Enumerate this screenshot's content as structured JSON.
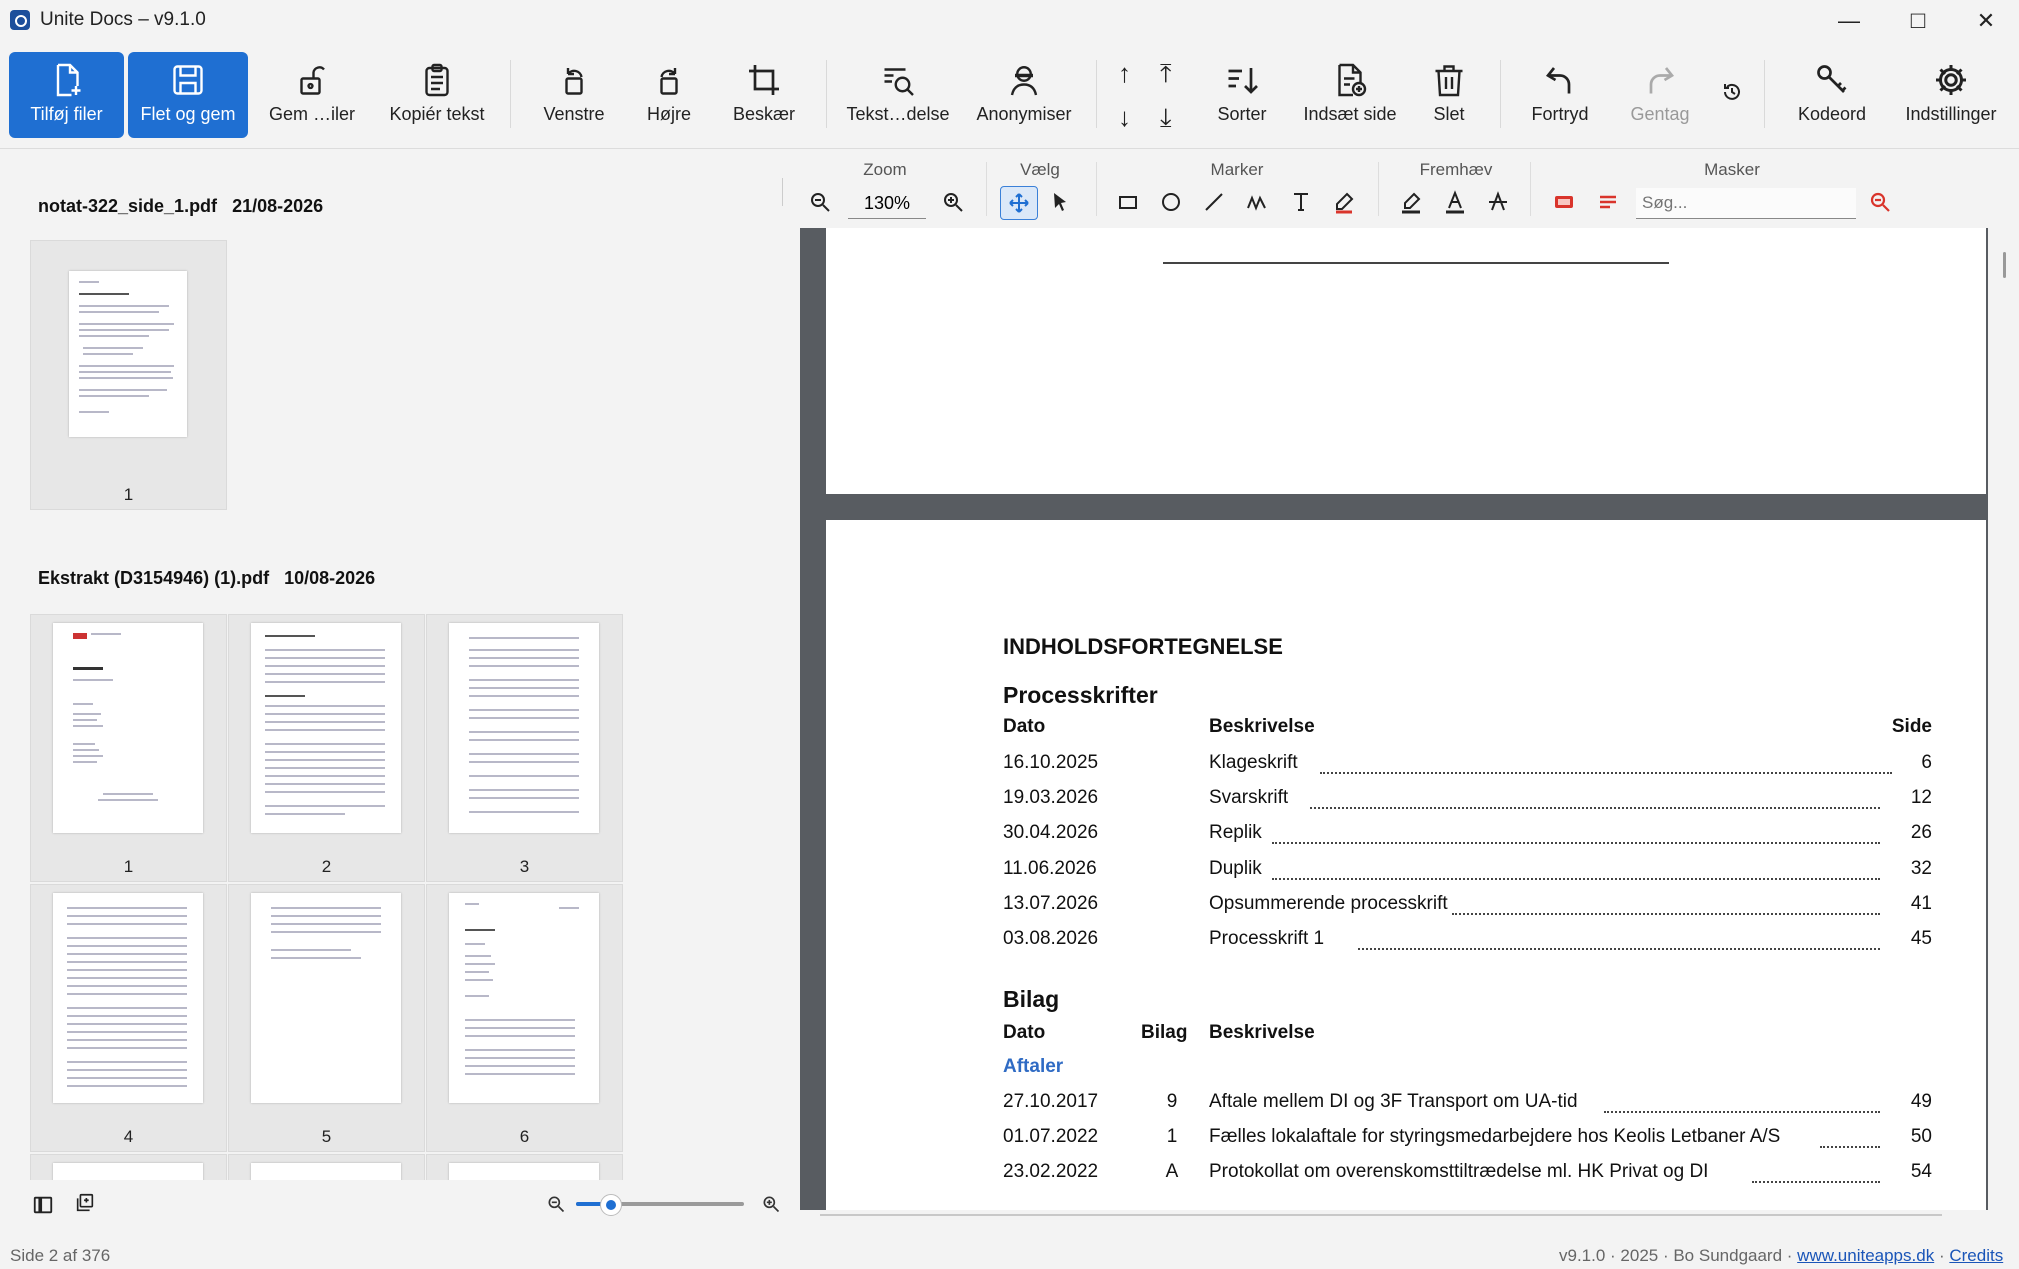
{
  "window": {
    "title": "Unite Docs – v9.1.0",
    "minimize": "—",
    "maximize": "□",
    "close": "✕"
  },
  "toolbar": {
    "add_files": "Tilføj filer",
    "merge_save": "Flet og gem",
    "save_files": "Gem …iler",
    "copy_text": "Kopiér tekst",
    "rotate_left": "Venstre",
    "rotate_right": "Højre",
    "crop": "Beskær",
    "text_search": "Tekst…delse",
    "anonymize": "Anonymiser",
    "sort": "Sorter",
    "insert_page": "Indsæt side",
    "delete": "Slet",
    "undo": "Fortryd",
    "redo": "Gentag",
    "password": "Kodeord",
    "settings": "Indstillinger"
  },
  "annotation_bar": {
    "zoom_label": "Zoom",
    "zoom_value": "130%",
    "select_label": "Vælg",
    "mark_label": "Marker",
    "highlight_label": "Fremhæv",
    "mask_label": "Masker",
    "search_placeholder": "Søg..."
  },
  "files": [
    {
      "name": "notat-322_side_1.pdf",
      "date": "21/08-2026",
      "pages": [
        "1"
      ]
    },
    {
      "name": "Ekstrakt (D3154946) (1).pdf",
      "date": "10/08-2026",
      "pages": [
        "1",
        "2",
        "3",
        "4",
        "5",
        "6"
      ]
    }
  ],
  "document": {
    "heading": "INDHOLDSFORTEGNELSE",
    "section1_title": "Processkrifter",
    "section1_headers": {
      "date": "Dato",
      "desc": "Beskrivelse",
      "page": "Side"
    },
    "section1_rows": [
      {
        "date": "16.10.2025",
        "desc": "Klageskrift",
        "page": "6"
      },
      {
        "date": "19.03.2026",
        "desc": "Svarskrift",
        "page": "12"
      },
      {
        "date": "30.04.2026",
        "desc": "Replik",
        "page": "26"
      },
      {
        "date": "11.06.2026",
        "desc": "Duplik",
        "page": "32"
      },
      {
        "date": "13.07.2026",
        "desc": "Opsummerende processkrift",
        "page": "41"
      },
      {
        "date": "03.08.2026",
        "desc": "Processkrift 1",
        "page": "45"
      }
    ],
    "section2_title": "Bilag",
    "section2_headers": {
      "date": "Dato",
      "annex": "Bilag",
      "desc": "Beskrivelse"
    },
    "section2_group": "Aftaler",
    "section2_rows": [
      {
        "date": "27.10.2017",
        "annex": "9",
        "desc": "Aftale mellem DI og 3F Transport om UA-tid",
        "page": "49"
      },
      {
        "date": "01.07.2022",
        "annex": "1",
        "desc": "Fælles lokalaftale for styringsmedarbejdere hos Keolis Letbaner A/S",
        "page": "50"
      },
      {
        "date": "23.02.2022",
        "annex": "A",
        "desc": "Protokollat om overenskomsttiltrædelse ml. HK Privat og DI",
        "page": "54"
      }
    ]
  },
  "thumb_zoom_level": 0.2,
  "status": {
    "page_info": "Side 2 af 376",
    "version_info": "v9.1.0 · 2025 · Bo Sundgaard ·",
    "website": "www.uniteapps.dk",
    "separator": "·",
    "credits": "Credits"
  },
  "colors": {
    "accent": "#1f6fd2",
    "viewer_bg": "#585c61",
    "link": "#1a55b8",
    "group_heading": "#2f6bc4",
    "mask_red": "#d9342b"
  }
}
